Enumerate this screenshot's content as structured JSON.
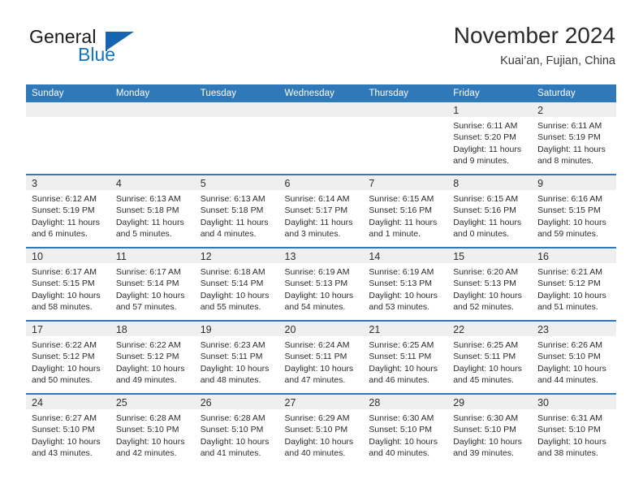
{
  "brand": {
    "name_part1": "General",
    "name_part2": "Blue",
    "flag_icon": "triangle-flag-icon",
    "accent_color": "#1565b0"
  },
  "header": {
    "title": "November 2024",
    "subtitle": "Kuai’an, Fujian, China"
  },
  "theme": {
    "header_bar_color": "#3079b8",
    "daystrip_color": "#efefef",
    "text_color": "#2b2b2b"
  },
  "weekdays": [
    "Sunday",
    "Monday",
    "Tuesday",
    "Wednesday",
    "Thursday",
    "Friday",
    "Saturday"
  ],
  "weeks": [
    [
      {
        "day": "",
        "sunrise": "",
        "sunset": "",
        "daylight_line1": "",
        "daylight_line2": ""
      },
      {
        "day": "",
        "sunrise": "",
        "sunset": "",
        "daylight_line1": "",
        "daylight_line2": ""
      },
      {
        "day": "",
        "sunrise": "",
        "sunset": "",
        "daylight_line1": "",
        "daylight_line2": ""
      },
      {
        "day": "",
        "sunrise": "",
        "sunset": "",
        "daylight_line1": "",
        "daylight_line2": ""
      },
      {
        "day": "",
        "sunrise": "",
        "sunset": "",
        "daylight_line1": "",
        "daylight_line2": ""
      },
      {
        "day": "1",
        "sunrise": "Sunrise: 6:11 AM",
        "sunset": "Sunset: 5:20 PM",
        "daylight_line1": "Daylight: 11 hours",
        "daylight_line2": "and 9 minutes."
      },
      {
        "day": "2",
        "sunrise": "Sunrise: 6:11 AM",
        "sunset": "Sunset: 5:19 PM",
        "daylight_line1": "Daylight: 11 hours",
        "daylight_line2": "and 8 minutes."
      }
    ],
    [
      {
        "day": "3",
        "sunrise": "Sunrise: 6:12 AM",
        "sunset": "Sunset: 5:19 PM",
        "daylight_line1": "Daylight: 11 hours",
        "daylight_line2": "and 6 minutes."
      },
      {
        "day": "4",
        "sunrise": "Sunrise: 6:13 AM",
        "sunset": "Sunset: 5:18 PM",
        "daylight_line1": "Daylight: 11 hours",
        "daylight_line2": "and 5 minutes."
      },
      {
        "day": "5",
        "sunrise": "Sunrise: 6:13 AM",
        "sunset": "Sunset: 5:18 PM",
        "daylight_line1": "Daylight: 11 hours",
        "daylight_line2": "and 4 minutes."
      },
      {
        "day": "6",
        "sunrise": "Sunrise: 6:14 AM",
        "sunset": "Sunset: 5:17 PM",
        "daylight_line1": "Daylight: 11 hours",
        "daylight_line2": "and 3 minutes."
      },
      {
        "day": "7",
        "sunrise": "Sunrise: 6:15 AM",
        "sunset": "Sunset: 5:16 PM",
        "daylight_line1": "Daylight: 11 hours",
        "daylight_line2": "and 1 minute."
      },
      {
        "day": "8",
        "sunrise": "Sunrise: 6:15 AM",
        "sunset": "Sunset: 5:16 PM",
        "daylight_line1": "Daylight: 11 hours",
        "daylight_line2": "and 0 minutes."
      },
      {
        "day": "9",
        "sunrise": "Sunrise: 6:16 AM",
        "sunset": "Sunset: 5:15 PM",
        "daylight_line1": "Daylight: 10 hours",
        "daylight_line2": "and 59 minutes."
      }
    ],
    [
      {
        "day": "10",
        "sunrise": "Sunrise: 6:17 AM",
        "sunset": "Sunset: 5:15 PM",
        "daylight_line1": "Daylight: 10 hours",
        "daylight_line2": "and 58 minutes."
      },
      {
        "day": "11",
        "sunrise": "Sunrise: 6:17 AM",
        "sunset": "Sunset: 5:14 PM",
        "daylight_line1": "Daylight: 10 hours",
        "daylight_line2": "and 57 minutes."
      },
      {
        "day": "12",
        "sunrise": "Sunrise: 6:18 AM",
        "sunset": "Sunset: 5:14 PM",
        "daylight_line1": "Daylight: 10 hours",
        "daylight_line2": "and 55 minutes."
      },
      {
        "day": "13",
        "sunrise": "Sunrise: 6:19 AM",
        "sunset": "Sunset: 5:13 PM",
        "daylight_line1": "Daylight: 10 hours",
        "daylight_line2": "and 54 minutes."
      },
      {
        "day": "14",
        "sunrise": "Sunrise: 6:19 AM",
        "sunset": "Sunset: 5:13 PM",
        "daylight_line1": "Daylight: 10 hours",
        "daylight_line2": "and 53 minutes."
      },
      {
        "day": "15",
        "sunrise": "Sunrise: 6:20 AM",
        "sunset": "Sunset: 5:13 PM",
        "daylight_line1": "Daylight: 10 hours",
        "daylight_line2": "and 52 minutes."
      },
      {
        "day": "16",
        "sunrise": "Sunrise: 6:21 AM",
        "sunset": "Sunset: 5:12 PM",
        "daylight_line1": "Daylight: 10 hours",
        "daylight_line2": "and 51 minutes."
      }
    ],
    [
      {
        "day": "17",
        "sunrise": "Sunrise: 6:22 AM",
        "sunset": "Sunset: 5:12 PM",
        "daylight_line1": "Daylight: 10 hours",
        "daylight_line2": "and 50 minutes."
      },
      {
        "day": "18",
        "sunrise": "Sunrise: 6:22 AM",
        "sunset": "Sunset: 5:12 PM",
        "daylight_line1": "Daylight: 10 hours",
        "daylight_line2": "and 49 minutes."
      },
      {
        "day": "19",
        "sunrise": "Sunrise: 6:23 AM",
        "sunset": "Sunset: 5:11 PM",
        "daylight_line1": "Daylight: 10 hours",
        "daylight_line2": "and 48 minutes."
      },
      {
        "day": "20",
        "sunrise": "Sunrise: 6:24 AM",
        "sunset": "Sunset: 5:11 PM",
        "daylight_line1": "Daylight: 10 hours",
        "daylight_line2": "and 47 minutes."
      },
      {
        "day": "21",
        "sunrise": "Sunrise: 6:25 AM",
        "sunset": "Sunset: 5:11 PM",
        "daylight_line1": "Daylight: 10 hours",
        "daylight_line2": "and 46 minutes."
      },
      {
        "day": "22",
        "sunrise": "Sunrise: 6:25 AM",
        "sunset": "Sunset: 5:11 PM",
        "daylight_line1": "Daylight: 10 hours",
        "daylight_line2": "and 45 minutes."
      },
      {
        "day": "23",
        "sunrise": "Sunrise: 6:26 AM",
        "sunset": "Sunset: 5:10 PM",
        "daylight_line1": "Daylight: 10 hours",
        "daylight_line2": "and 44 minutes."
      }
    ],
    [
      {
        "day": "24",
        "sunrise": "Sunrise: 6:27 AM",
        "sunset": "Sunset: 5:10 PM",
        "daylight_line1": "Daylight: 10 hours",
        "daylight_line2": "and 43 minutes."
      },
      {
        "day": "25",
        "sunrise": "Sunrise: 6:28 AM",
        "sunset": "Sunset: 5:10 PM",
        "daylight_line1": "Daylight: 10 hours",
        "daylight_line2": "and 42 minutes."
      },
      {
        "day": "26",
        "sunrise": "Sunrise: 6:28 AM",
        "sunset": "Sunset: 5:10 PM",
        "daylight_line1": "Daylight: 10 hours",
        "daylight_line2": "and 41 minutes."
      },
      {
        "day": "27",
        "sunrise": "Sunrise: 6:29 AM",
        "sunset": "Sunset: 5:10 PM",
        "daylight_line1": "Daylight: 10 hours",
        "daylight_line2": "and 40 minutes."
      },
      {
        "day": "28",
        "sunrise": "Sunrise: 6:30 AM",
        "sunset": "Sunset: 5:10 PM",
        "daylight_line1": "Daylight: 10 hours",
        "daylight_line2": "and 40 minutes."
      },
      {
        "day": "29",
        "sunrise": "Sunrise: 6:30 AM",
        "sunset": "Sunset: 5:10 PM",
        "daylight_line1": "Daylight: 10 hours",
        "daylight_line2": "and 39 minutes."
      },
      {
        "day": "30",
        "sunrise": "Sunrise: 6:31 AM",
        "sunset": "Sunset: 5:10 PM",
        "daylight_line1": "Daylight: 10 hours",
        "daylight_line2": "and 38 minutes."
      }
    ]
  ]
}
